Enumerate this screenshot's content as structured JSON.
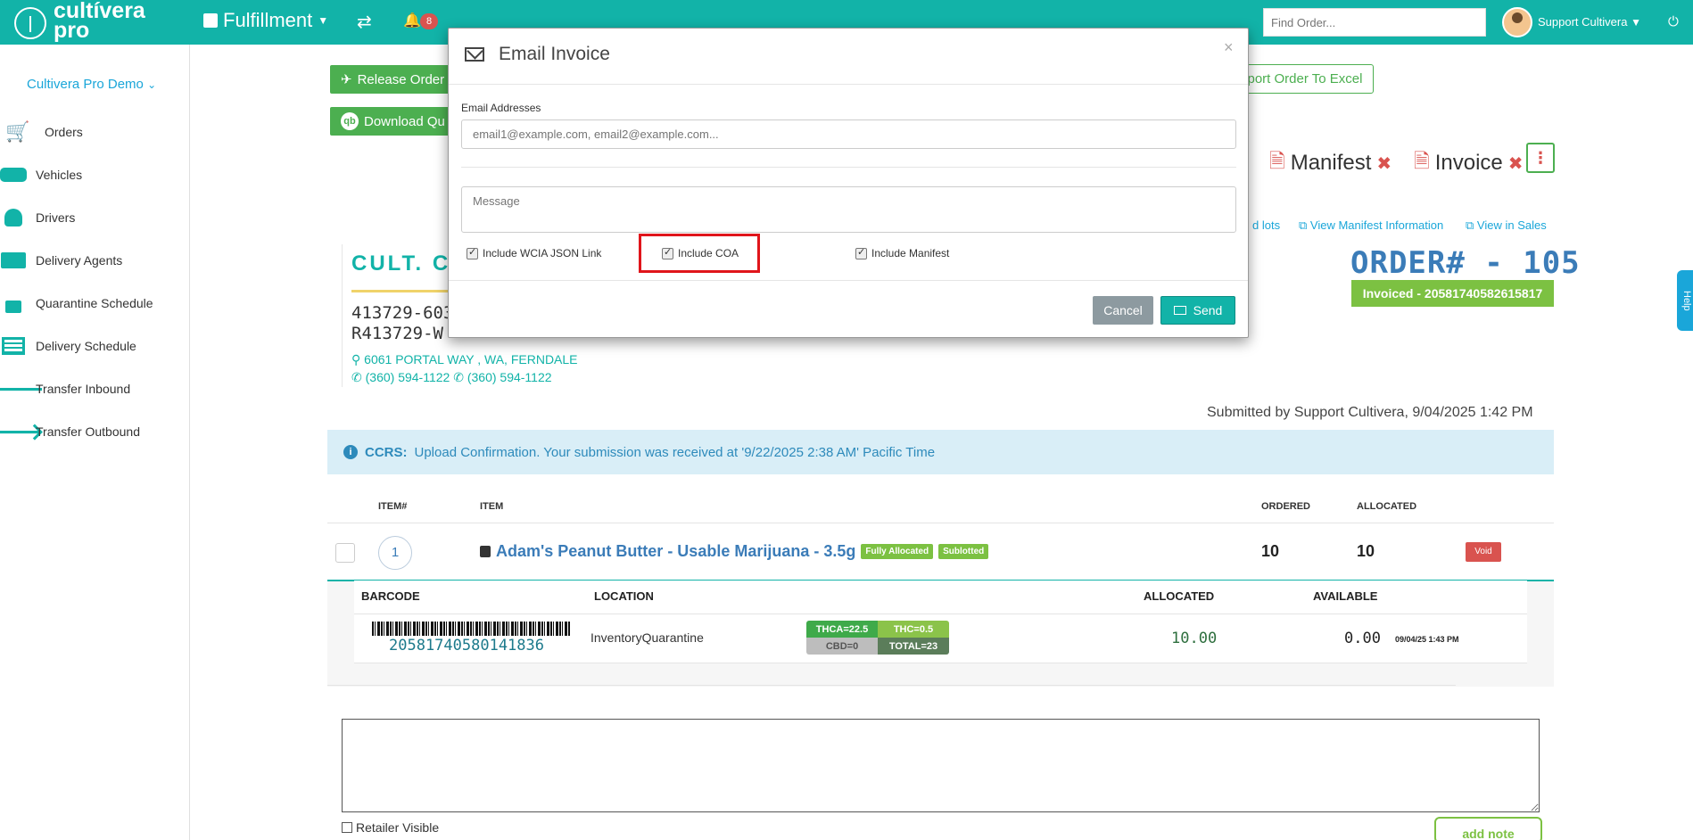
{
  "topbar": {
    "logo_line1": "cultívera",
    "logo_line2": "pro",
    "module": "Fulfillment",
    "notification_count": "8",
    "find_order_placeholder": "Find Order...",
    "user_name": "Support Cultivera"
  },
  "sidebar": {
    "org": "Cultivera Pro Demo",
    "items": [
      {
        "label": "Orders",
        "icon": "cart-icon"
      },
      {
        "label": "Vehicles",
        "icon": "car-icon"
      },
      {
        "label": "Drivers",
        "icon": "user-icon"
      },
      {
        "label": "Delivery Agents",
        "icon": "truck-icon"
      },
      {
        "label": "Quarantine Schedule",
        "icon": "unlock-icon"
      },
      {
        "label": "Delivery Schedule",
        "icon": "list-icon"
      },
      {
        "label": "Transfer Inbound",
        "icon": "arrow-left-icon"
      },
      {
        "label": "Transfer Outbound",
        "icon": "arrow-right-icon"
      }
    ]
  },
  "actions": {
    "release_order": "Release Order",
    "download_qb": "Download Qu",
    "export_excel": "xport Order To Excel",
    "manifest": "Manifest",
    "invoice": "Invoice",
    "link_lots": "d lots",
    "link_manifest_info": "View Manifest Information",
    "link_view_sales": "View in Sales"
  },
  "customer": {
    "name": "CULT. CA",
    "license1": "413729-603",
    "license2": "R413729-W",
    "address": "6061 PORTAL WAY , WA, FERNDALE",
    "phone1": "(360) 594-1122",
    "phone2": "(360) 594-1122"
  },
  "order": {
    "number": "ORDER# - 105",
    "status": "Invoiced - 20581740582615817",
    "submitted": "Submitted by Support Cultivera, 9/04/2025 1:42 PM",
    "ccrs_label": "CCRS:",
    "ccrs_message": "Upload Confirmation. Your submission was received at '9/22/2025 2:38 AM' Pacific Time"
  },
  "table": {
    "headers": {
      "item_no": "ITEM#",
      "item": "ITEM",
      "ordered": "ORDERED",
      "allocated": "ALLOCATED"
    },
    "row": {
      "num": "1",
      "product": "Adam's Peanut Butter - Usable Marijuana - 3.5g",
      "tag1": "Fully Allocated",
      "tag2": "Sublotted",
      "ordered": "10",
      "allocated": "10",
      "void": "Void"
    },
    "sub_headers": {
      "barcode": "BARCODE",
      "location": "LOCATION",
      "allocated": "ALLOCATED",
      "available": "AVAILABLE"
    },
    "sub_row": {
      "barcode": "20581740580141836",
      "location": "InventoryQuarantine",
      "thca": "THCA=22.5",
      "thc": "THC=0.5",
      "cbd": "CBD=0",
      "total": "TOTAL=23",
      "allocated": "10.00",
      "available": "0.00",
      "date": "09/04/25 1:43 PM"
    }
  },
  "notes": {
    "retailer_visible": "Retailer Visible",
    "add_note": "add note"
  },
  "help": "Help",
  "modal": {
    "title": "Email Invoice",
    "email_label": "Email Addresses",
    "email_placeholder": "email1@example.com, email2@example.com...",
    "message_placeholder": "Message",
    "opt_wcia": "Include WCIA JSON Link",
    "opt_coa": "Include COA",
    "opt_manifest": "Include Manifest",
    "cancel": "Cancel",
    "send": "Send"
  },
  "colors": {
    "brand": "#12b3a8",
    "link": "#1aa6d9",
    "danger": "#d9534f",
    "success": "#7cc142",
    "highlight": "#e0151b"
  }
}
